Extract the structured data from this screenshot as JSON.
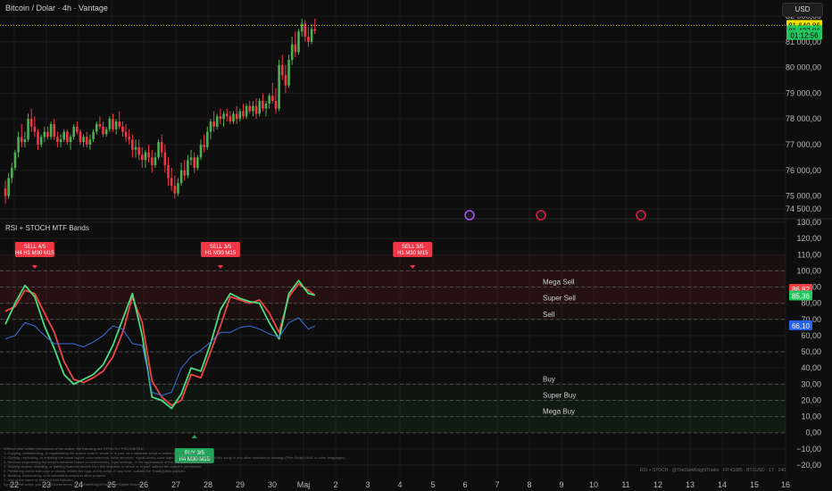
{
  "header": {
    "title": "Bitcoin / Dolar · 4h · Vantage",
    "currency": "USD"
  },
  "indicator": {
    "title": "RSI + STOCH MTF Bands"
  },
  "chart_data": [
    {
      "type": "candlestick",
      "title": "Bitcoin / Dolar · 4h · Vantage",
      "ylim": [
        74500,
        82000
      ],
      "yticks": [
        74500,
        75000,
        76000,
        77000,
        78000,
        79000,
        80000,
        81000,
        82000
      ],
      "ytick_labels": [
        "74 500,00",
        "75 000,00",
        "76 000,00",
        "77 000,00",
        "78 000,00",
        "79 000,00",
        "80 000,00",
        "81 000,00",
        "82 000,00"
      ],
      "xlabels": [
        "22",
        "23",
        "24",
        "25",
        "26",
        "27",
        "28",
        "29",
        "30",
        "Maj",
        "2",
        "3",
        "4",
        "5",
        "6",
        "7",
        "8",
        "9",
        "10",
        "11",
        "12",
        "13",
        "14",
        "15",
        "16"
      ],
      "price_labels": [
        {
          "text": "81 640,86",
          "value": 81640,
          "color": "#f0e000"
        },
        {
          "text": "81 427,86",
          "value": 81430,
          "color": "#22c55e"
        },
        {
          "text": "01:12:56",
          "value": 81250,
          "color": "#22c55e"
        }
      ],
      "candles": [
        [
          75300,
          75600,
          74700,
          75000
        ],
        [
          75000,
          75900,
          74900,
          75700
        ],
        [
          75700,
          76300,
          75500,
          76100
        ],
        [
          76100,
          76800,
          76000,
          76700
        ],
        [
          76700,
          77500,
          76500,
          77300
        ],
        [
          77300,
          77800,
          76900,
          77100
        ],
        [
          77100,
          77500,
          76900,
          77200
        ],
        [
          77200,
          78200,
          77100,
          78000
        ],
        [
          78000,
          78400,
          77500,
          77700
        ],
        [
          77700,
          78100,
          77300,
          77500
        ],
        [
          77500,
          77600,
          76800,
          77000
        ],
        [
          77000,
          77400,
          76900,
          77300
        ],
        [
          77300,
          77700,
          77100,
          77500
        ],
        [
          77500,
          77700,
          77200,
          77300
        ],
        [
          77300,
          77900,
          77200,
          77800
        ],
        [
          77800,
          78000,
          77200,
          77300
        ],
        [
          77300,
          77500,
          76900,
          77100
        ],
        [
          77100,
          77400,
          76900,
          77200
        ],
        [
          77200,
          77600,
          77100,
          77500
        ],
        [
          77500,
          77600,
          77000,
          77100
        ],
        [
          77100,
          77400,
          76800,
          77300
        ],
        [
          77300,
          77800,
          77200,
          77700
        ],
        [
          77700,
          77900,
          77400,
          77500
        ],
        [
          77500,
          77600,
          77000,
          77100
        ],
        [
          77100,
          77400,
          76900,
          77300
        ],
        [
          77300,
          77500,
          76900,
          77000
        ],
        [
          77000,
          77400,
          76800,
          77200
        ],
        [
          77200,
          77600,
          77100,
          77500
        ],
        [
          77500,
          77900,
          77400,
          77800
        ],
        [
          77800,
          78100,
          77600,
          77700
        ],
        [
          77700,
          77900,
          77300,
          77400
        ],
        [
          77400,
          77700,
          77300,
          77600
        ],
        [
          77600,
          78100,
          77500,
          78000
        ],
        [
          78000,
          78200,
          77500,
          77600
        ],
        [
          77600,
          78000,
          77400,
          77900
        ],
        [
          77900,
          78300,
          77600,
          77700
        ],
        [
          77700,
          77900,
          77300,
          77500
        ],
        [
          77500,
          77800,
          77100,
          77300
        ],
        [
          77300,
          77600,
          77000,
          77200
        ],
        [
          77200,
          77400,
          76500,
          76800
        ],
        [
          76800,
          77200,
          76500,
          76900
        ],
        [
          76900,
          77200,
          76400,
          76600
        ],
        [
          76600,
          76900,
          76100,
          76400
        ],
        [
          76400,
          76800,
          76100,
          76700
        ],
        [
          76700,
          77000,
          76300,
          76500
        ],
        [
          76500,
          76800,
          75900,
          76200
        ],
        [
          76200,
          76700,
          76100,
          76500
        ],
        [
          76500,
          77200,
          76400,
          77100
        ],
        [
          77100,
          77400,
          76500,
          76700
        ],
        [
          76700,
          77000,
          75900,
          76200
        ],
        [
          76200,
          76500,
          75400,
          75700
        ],
        [
          75700,
          76100,
          75200,
          75400
        ],
        [
          75400,
          75800,
          74900,
          75100
        ],
        [
          75100,
          75700,
          75000,
          75500
        ],
        [
          75500,
          76300,
          75400,
          76000
        ],
        [
          76000,
          76400,
          75600,
          75800
        ],
        [
          75800,
          76600,
          75700,
          76400
        ],
        [
          76400,
          76800,
          76200,
          76500
        ],
        [
          76500,
          76700,
          75900,
          76100
        ],
        [
          76100,
          76600,
          76000,
          76500
        ],
        [
          76500,
          77200,
          76400,
          77000
        ],
        [
          77000,
          77400,
          76700,
          76900
        ],
        [
          76900,
          77700,
          76800,
          77500
        ],
        [
          77500,
          78000,
          77200,
          77900
        ],
        [
          77900,
          78300,
          77500,
          77700
        ],
        [
          77700,
          78200,
          77600,
          78100
        ],
        [
          78100,
          78400,
          77800,
          78000
        ],
        [
          78000,
          78300,
          77700,
          78200
        ],
        [
          78200,
          78400,
          77900,
          78100
        ],
        [
          78100,
          78300,
          77800,
          77900
        ],
        [
          77900,
          78300,
          77800,
          78200
        ],
        [
          78200,
          78500,
          77800,
          78000
        ],
        [
          78000,
          78400,
          77900,
          78300
        ],
        [
          78300,
          78600,
          78000,
          78100
        ],
        [
          78100,
          78600,
          78000,
          78500
        ],
        [
          78500,
          78700,
          78200,
          78300
        ],
        [
          78300,
          78700,
          78100,
          78500
        ],
        [
          78500,
          78800,
          78000,
          78200
        ],
        [
          78200,
          78800,
          78100,
          78700
        ],
        [
          78700,
          79000,
          78300,
          78400
        ],
        [
          78400,
          78700,
          78100,
          78600
        ],
        [
          78600,
          79000,
          78400,
          78900
        ],
        [
          78900,
          79400,
          78600,
          78700
        ],
        [
          78700,
          79200,
          78200,
          78400
        ],
        [
          78400,
          80300,
          78300,
          80100
        ],
        [
          80100,
          80500,
          79500,
          79700
        ],
        [
          79700,
          80100,
          79000,
          79300
        ],
        [
          79300,
          80500,
          79200,
          80300
        ],
        [
          80300,
          81200,
          80100,
          80900
        ],
        [
          80900,
          81400,
          80400,
          80600
        ],
        [
          80600,
          81500,
          80500,
          81400
        ],
        [
          81400,
          81900,
          81200,
          81700
        ],
        [
          81700,
          81850,
          81000,
          81200
        ],
        [
          81200,
          81600,
          80800,
          81000
        ],
        [
          81000,
          81700,
          80900,
          81500
        ],
        [
          81500,
          81900,
          81300,
          81430
        ]
      ]
    },
    {
      "type": "line",
      "title": "RSI + STOCH MTF Bands",
      "ylim": [
        -20,
        130
      ],
      "yticks": [
        -20,
        -10,
        0,
        10,
        20,
        30,
        40,
        50,
        60,
        70,
        80,
        90,
        100,
        110,
        120,
        130
      ],
      "ytick_labels": [
        "−20,00",
        "−10,00",
        "0,00",
        "10,00",
        "20,00",
        "30,00",
        "40,00",
        "50,00",
        "60,00",
        "70,00",
        "80,00",
        "90,00",
        "100,00",
        "110,00",
        "120,00",
        "130,00"
      ],
      "bands": [
        {
          "label": "Mega Sell",
          "value": 90
        },
        {
          "label": "Super Sell",
          "value": 80
        },
        {
          "label": "Sell",
          "value": 70
        },
        {
          "label": "",
          "value": 50
        },
        {
          "label": "Buy",
          "value": 30
        },
        {
          "label": "Super Buy",
          "value": 20
        },
        {
          "label": "Mega Buy",
          "value": 10
        }
      ],
      "x_index": [
        0,
        3,
        6,
        9,
        12,
        15,
        18,
        21,
        24,
        27,
        30,
        33,
        36,
        39,
        42,
        45,
        48,
        51,
        54,
        57,
        60,
        63,
        66,
        69,
        72,
        75,
        78,
        81,
        84,
        87,
        90,
        93,
        95
      ],
      "series": [
        {
          "name": "",
          "color": "#ef4444",
          "values": [
            75,
            78,
            88,
            86,
            74,
            62,
            44,
            33,
            31,
            34,
            38,
            47,
            62,
            84,
            68,
            32,
            22,
            17,
            20,
            36,
            34,
            50,
            66,
            84,
            82,
            80,
            82,
            74,
            62,
            84,
            92,
            88,
            85
          ]
        },
        {
          "name": "",
          "color": "#4ade80",
          "values": [
            67,
            80,
            91,
            84,
            66,
            52,
            36,
            30,
            33,
            36,
            42,
            54,
            70,
            86,
            60,
            22,
            20,
            15,
            24,
            40,
            38,
            55,
            76,
            86,
            83,
            81,
            80,
            68,
            58,
            86,
            94,
            86,
            85
          ]
        },
        {
          "name": "",
          "color": "#3b6fd9",
          "values": [
            58,
            60,
            68,
            66,
            60,
            55,
            55,
            55,
            53,
            56,
            60,
            66,
            64,
            55,
            54,
            25,
            23,
            25,
            40,
            47,
            51,
            56,
            62,
            62,
            65,
            66,
            64,
            61,
            59,
            68,
            71,
            64,
            66
          ]
        }
      ],
      "value_labels": [
        {
          "text": "86,82",
          "value": 88.6,
          "color": "#ef4444"
        },
        {
          "text": "85,36",
          "value": 84.5,
          "color": "#22c55e"
        },
        {
          "text": "66,10",
          "value": 66.1,
          "color": "#2563eb"
        }
      ],
      "signals": [
        {
          "kind": "sell",
          "lines": [
            "SELL 4/5",
            "H4 H1 M30 M15"
          ],
          "at_index": 9
        },
        {
          "kind": "sell",
          "lines": [
            "SELL 3/5",
            "H1 M30 M15"
          ],
          "at_index": 66
        },
        {
          "kind": "sell",
          "lines": [
            "SELL 3/5",
            "H1 M30 M15"
          ],
          "at_index": 125
        },
        {
          "kind": "buy",
          "lines": [
            "BUY 3/5",
            "H4 M30 M15"
          ],
          "at_index": 58
        }
      ]
    }
  ],
  "footer": {
    "disclaimer": [
      "Without prior written permission of the author, the following are STRICTLY PROHIBITED:",
      "1. Copying, redistributing, or republishing the source code in whole or in part, as a separate script or within other indicators.",
      "2. Cloning, replicating, or imitating the visual layout, color schemes, table structure, signal labels, color logic, or trade setup behavior of this script in any other indicator or strategy (Pine Script v5/v6 or other languages).",
      "3. Reverse-engineering the script's behavior based on screenshots, input settings, or the appearance of the trade setup on the chart.",
      "4. Sharing access, reselling, or gaining financial benefit from this indicator, in whole or in part, without the author's permission.",
      "5. Publishing works that copy or closely imitate the logic of this script, in any form, outside the TradingView platform.",
      "6. Building, customizing, or broadcasting scripts in other projects.",
      "7. Use of the name or brand of this indicator.",
      "By using this script, you accept these terms. © TheDarkKnightTrader. All Rights Reserved."
    ],
    "credit": "RSI + STOCH · @TheDarkKnightTrader · FP 43385 · BTCUSD · 1Y · 240"
  }
}
